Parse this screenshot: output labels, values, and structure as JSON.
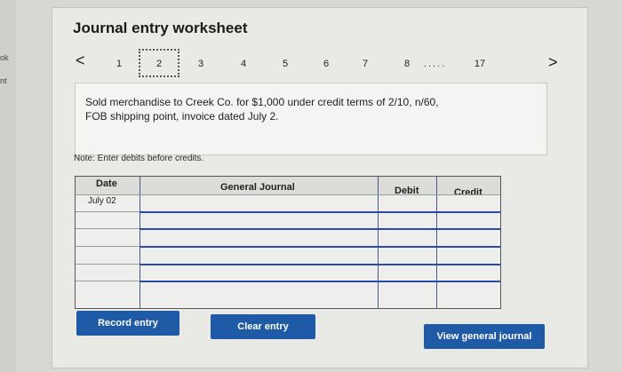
{
  "left_strip": {
    "labels": [
      "ok",
      "nt"
    ]
  },
  "title": "Journal entry worksheet",
  "pagination": {
    "prev": "<",
    "next": ">",
    "pages": [
      "1",
      "2",
      "3",
      "4",
      "5",
      "6",
      "7",
      "8",
      "17"
    ],
    "ellipsis": ".....",
    "active": "2"
  },
  "transaction": {
    "line1": "Sold merchandise to Creek Co. for $1,000 under credit terms of 2/10, n/60,",
    "line2": "FOB shipping point, invoice dated July 2."
  },
  "note": "Note: Enter debits before credits.",
  "table": {
    "headers": {
      "date": "Date",
      "journal": "General Journal",
      "debit": "Debit",
      "credit": "Credit"
    },
    "rows": [
      {
        "date": "July 02",
        "account": "",
        "debit": "",
        "credit": ""
      },
      {
        "date": "",
        "account": "",
        "debit": "",
        "credit": ""
      },
      {
        "date": "",
        "account": "",
        "debit": "",
        "credit": ""
      },
      {
        "date": "",
        "account": "",
        "debit": "",
        "credit": ""
      },
      {
        "date": "",
        "account": "",
        "debit": "",
        "credit": ""
      },
      {
        "date": "",
        "account": "",
        "debit": "",
        "credit": ""
      }
    ]
  },
  "buttons": {
    "record": "Record entry",
    "clear": "Clear entry",
    "view": "View general journal"
  },
  "colors": {
    "button": "#1f5aa6",
    "grid_line": "#2d4aa8"
  }
}
